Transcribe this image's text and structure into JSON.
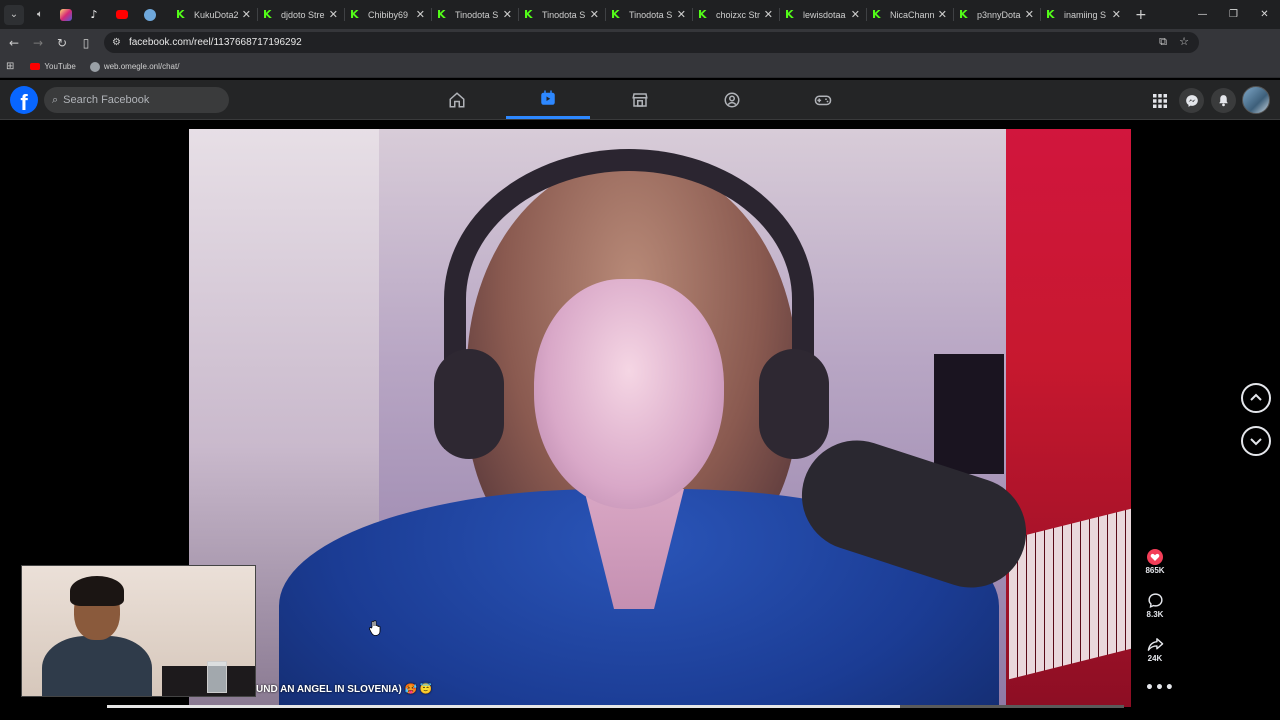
{
  "browser": {
    "pinned_tabs": [
      {
        "icon": "audio-icon",
        "color": "#c8c8c8"
      },
      {
        "icon": "instagram-icon",
        "color": "#e1306c"
      },
      {
        "icon": "tiktok-icon",
        "color": "#ffffff"
      },
      {
        "icon": "youtube-icon",
        "color": "#ff0000"
      },
      {
        "icon": "omegle-icon",
        "color": "#6fa8dc"
      }
    ],
    "tabs": [
      {
        "title": "KukuDota2"
      },
      {
        "title": "djdoto Stre"
      },
      {
        "title": "Chibiby69"
      },
      {
        "title": "Tinodota S"
      },
      {
        "title": "Tinodota S"
      },
      {
        "title": "Tinodota S"
      },
      {
        "title": "choizxc Str"
      },
      {
        "title": "lewisdotaa"
      },
      {
        "title": "NicaChann"
      },
      {
        "title": "p3nnyDota"
      },
      {
        "title": "inamiing S"
      }
    ],
    "tab_icon_color": "#53fc18",
    "url": "facebook.com/reel/1137668717196292",
    "bookmarks": [
      {
        "label": "YouTube",
        "color": "#ff0000"
      },
      {
        "label": "web.omegle.onl/chat/",
        "color": "#9aa0a6"
      }
    ]
  },
  "facebook": {
    "search_placeholder": "Search Facebook",
    "nav": [
      {
        "name": "home",
        "active": false
      },
      {
        "name": "reels",
        "active": true
      },
      {
        "name": "marketplace",
        "active": false
      },
      {
        "name": "groups",
        "active": false
      },
      {
        "name": "gaming",
        "active": false
      }
    ],
    "accent": "#2d88ff"
  },
  "reel": {
    "caption": "UND AN ANGEL IN SLOVENIA) 🥵 😇",
    "likes": "865K",
    "comments": "8.3K",
    "shares": "24K",
    "progress": 0.78
  }
}
